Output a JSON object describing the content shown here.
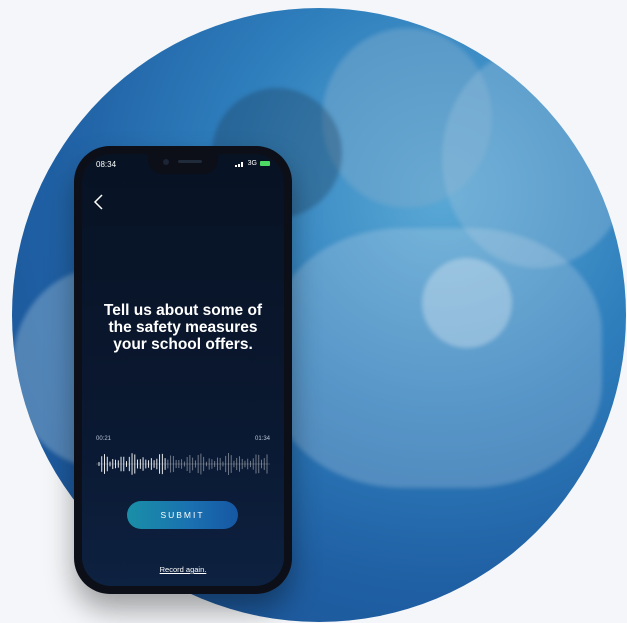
{
  "status_bar": {
    "time": "08:34",
    "network": "3G"
  },
  "prompt": {
    "text": "Tell us about some of the safety measures your school offers."
  },
  "recording": {
    "elapsed": "00:21",
    "total": "01:34",
    "progress": 0.4
  },
  "actions": {
    "submit_label": "SUBMIT",
    "record_again_label": "Record again."
  },
  "colors": {
    "circle_bg": "#2f7fbd",
    "screen_bg": "#071223",
    "button": "#1a6fb0"
  },
  "icons": {
    "back": "chevron-left-icon",
    "signal": "signal-bars-icon",
    "battery": "battery-icon"
  }
}
